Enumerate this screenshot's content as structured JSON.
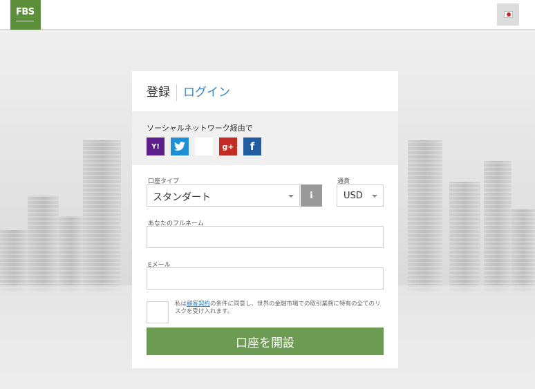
{
  "header": {
    "logo_text": "FBS",
    "language_icon": "japan-flag-icon"
  },
  "tabs": {
    "register": "登録",
    "login": "ログイン"
  },
  "social": {
    "label": "ソーシャルネットワーク経由で",
    "buttons": [
      {
        "name": "yahoo",
        "glyph": "Y!",
        "color": "#5c1f8a"
      },
      {
        "name": "twitter",
        "glyph": "t",
        "color": "#1e8fd6"
      },
      {
        "name": "microsoft",
        "glyph": "",
        "color": "#ffffff"
      },
      {
        "name": "google-plus",
        "glyph": "g+",
        "color": "#c52b25"
      },
      {
        "name": "facebook",
        "glyph": "f",
        "color": "#1f5ca0"
      }
    ]
  },
  "form": {
    "account_type_label": "口座タイプ",
    "account_type_value": "スタンダート",
    "info_glyph": "i",
    "currency_label": "通貨",
    "currency_value": "USD",
    "fullname_label": "あなたのフルネーム",
    "fullname_value": "",
    "email_label": "Eメール",
    "email_value": "",
    "agree_prefix": "私は",
    "agree_link": "顧客契約",
    "agree_suffix": "の条件に同意し、世界の金融市場での取引業務に特有の全てのリスクを受け入れます。",
    "submit_label": "口座を開設"
  },
  "colors": {
    "brand": "#5d8f3a",
    "submit": "#6e9b54",
    "link": "#3a86c8"
  }
}
